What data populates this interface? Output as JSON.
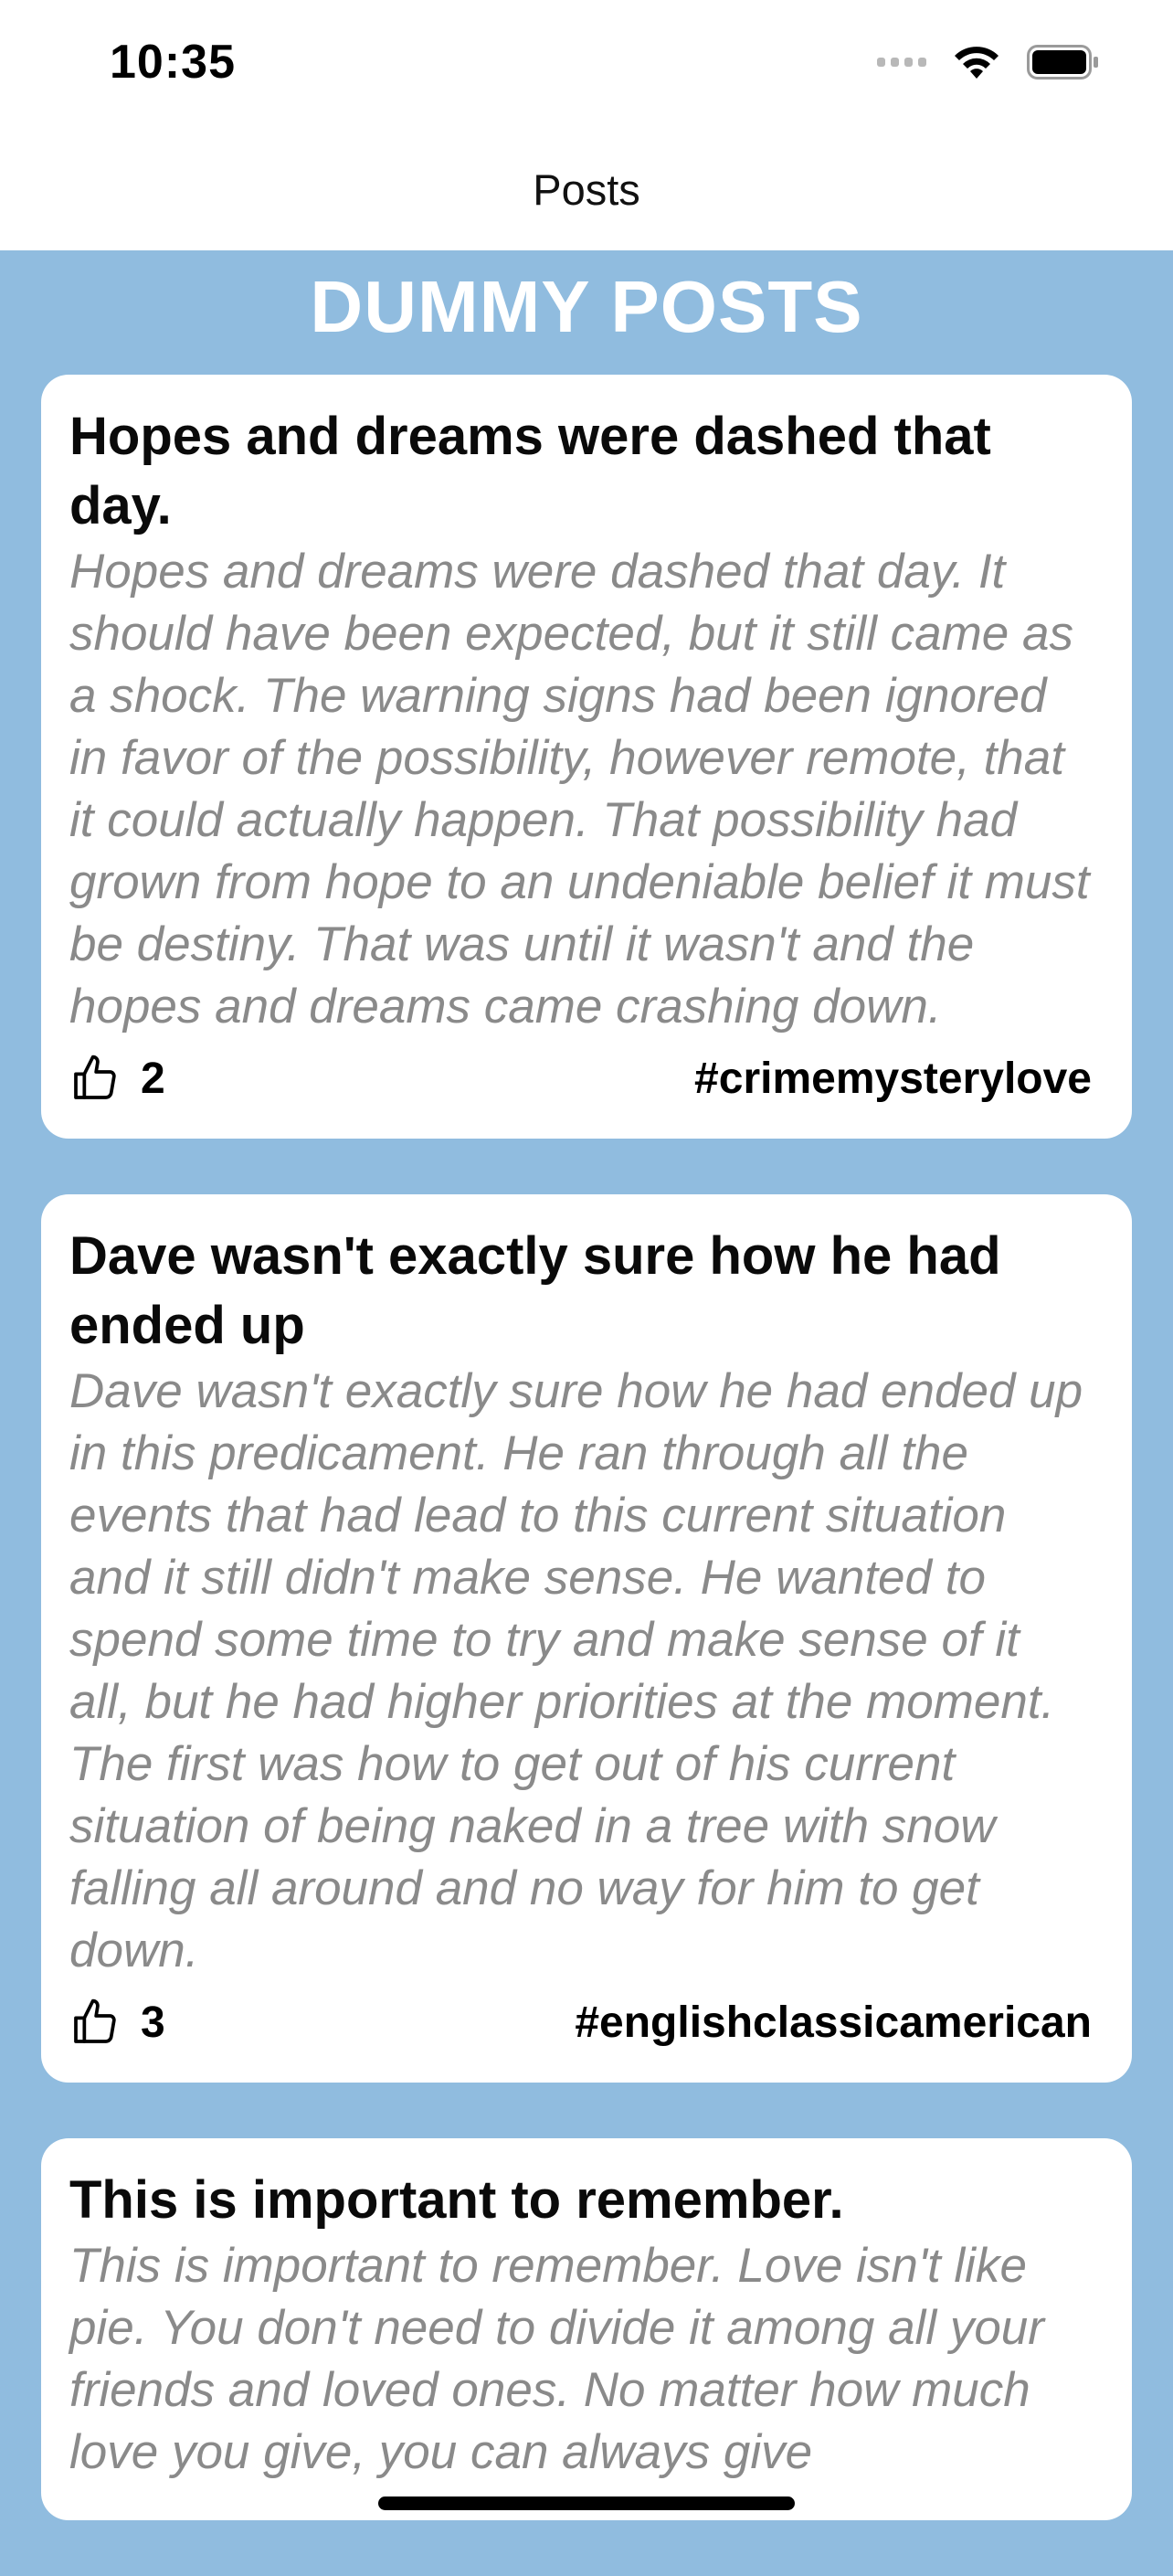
{
  "status_bar": {
    "time": "10:35"
  },
  "nav": {
    "title": "Posts"
  },
  "heading": "DUMMY POSTS",
  "posts": [
    {
      "title": "Hopes and dreams were dashed that day.",
      "body": "Hopes and dreams were dashed that day. It should have been expected, but it still came as a shock. The warning signs had been ignored in favor of the possibility, however remote, that it could actually happen. That possibility had grown from hope to an undeniable belief it must be destiny. That was until it wasn't and the hopes and dreams came crashing down.",
      "likes": "2",
      "tags": "#crimemysterylove"
    },
    {
      "title": "Dave wasn't exactly sure how he had ended up",
      "body": "Dave wasn't exactly sure how he had ended up in this predicament. He ran through all the events that had lead to this current situation and it still didn't make sense. He wanted to spend some time to try and make sense of it all, but he had higher priorities at the moment. The first was how to get out of his current situation of being naked in a tree with snow falling all around and no way for him to get down.",
      "likes": "3",
      "tags": "#englishclassicamerican"
    },
    {
      "title": "This is important to remember.",
      "body": "This is important to remember. Love isn't like pie. You don't need to divide it among all your friends and loved ones. No matter how much love you give, you can always give",
      "likes": "",
      "tags": ""
    }
  ],
  "icons": {
    "like": "thumbs-up-icon",
    "wifi": "wifi-icon",
    "battery": "battery-icon",
    "signal": "cellular-signal-icon"
  },
  "colors": {
    "background": "#90bcdf",
    "card": "#ffffff",
    "body_text": "#8a8a8a"
  }
}
